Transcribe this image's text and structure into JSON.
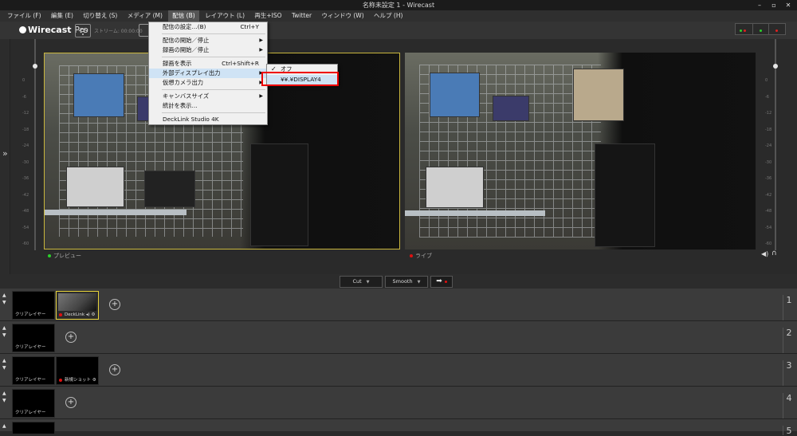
{
  "window": {
    "title": "名称未設定 1 - Wirecast",
    "min": "–",
    "max": "▫",
    "close": "✕"
  },
  "menubar": [
    {
      "label": "ファイル (F)"
    },
    {
      "label": "編集 (E)"
    },
    {
      "label": "切り替え (S)"
    },
    {
      "label": "メディア (M)"
    },
    {
      "label": "配信 (B)",
      "active": true
    },
    {
      "label": "レイアウト (L)"
    },
    {
      "label": "再生+ISO"
    },
    {
      "label": "Twitter"
    },
    {
      "label": "ウィンドウ (W)"
    },
    {
      "label": "ヘルプ (H)"
    }
  ],
  "toolbar": {
    "logo_name": "Wirecast",
    "logo_edition": "Pro",
    "stream_text": "ストリーム: 00:00:00"
  },
  "broadcast_menu": {
    "items": [
      {
        "label": "配信の設定…(B)",
        "shortcut": "Ctrl+Y"
      },
      {
        "sep": true
      },
      {
        "label": "配信の開始／停止",
        "submenu": true
      },
      {
        "label": "録画の開始／停止",
        "submenu": true
      },
      {
        "sep": true
      },
      {
        "label": "録画を表示",
        "shortcut": "Ctrl+Shift+R"
      },
      {
        "label": "外部ディスプレイ出力",
        "submenu": true,
        "highlighted": true
      },
      {
        "label": "仮想カメラ出力",
        "submenu": true
      },
      {
        "sep": true
      },
      {
        "label": "キャンバスサイズ",
        "submenu": true
      },
      {
        "label": "統計を表示…"
      },
      {
        "sep": true
      },
      {
        "label": "DeckLink Studio 4K"
      }
    ]
  },
  "external_display_submenu": {
    "items": [
      {
        "label": "オフ",
        "checked": true
      },
      {
        "label": "¥¥.¥DISPLAY4",
        "highlighted": true
      }
    ]
  },
  "preview_label": "プレビュー",
  "live_label": "ライブ",
  "meter_ticks": [
    "0",
    "-6",
    "-12",
    "-18",
    "-24",
    "-30",
    "-36",
    "-42",
    "-48",
    "-54",
    "-60"
  ],
  "transition": {
    "cut": "Cut",
    "smooth": "Smooth",
    "go_arrow": "➡"
  },
  "layers": [
    {
      "number": "1",
      "shots": [
        {
          "label": "クリアレイヤー"
        },
        {
          "label": "DeckLink",
          "selected": true,
          "live": true
        }
      ]
    },
    {
      "number": "2",
      "shots": [
        {
          "label": "クリアレイヤー"
        }
      ]
    },
    {
      "number": "3",
      "shots": [
        {
          "label": "クリアレイヤー"
        },
        {
          "label": "新規ショット",
          "live": true
        }
      ]
    },
    {
      "number": "4",
      "shots": [
        {
          "label": "クリアレイヤー"
        }
      ]
    },
    {
      "number": "5",
      "shots": [
        {
          "label": ""
        }
      ]
    }
  ],
  "colors": {
    "preview_border": "#c9b63d",
    "live_red": "#e01010",
    "selection_red": "#e00000",
    "menu_bg": "#f0f0f0"
  }
}
